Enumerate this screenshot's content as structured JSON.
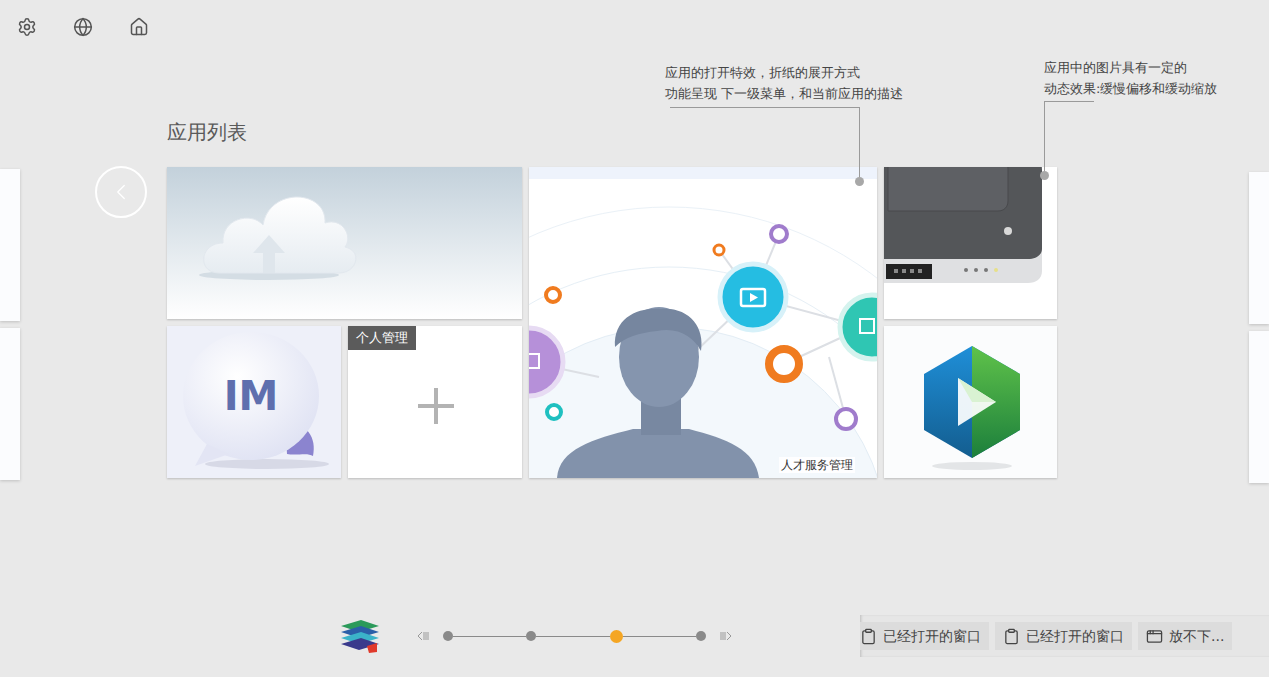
{
  "title": "应用列表",
  "annotations": [
    {
      "lines": [
        "应用的打开特效，折纸的展开方式",
        "功能呈现 下一级菜单，和当前应用的描述"
      ]
    },
    {
      "lines": [
        "应用中的图片具有一定的",
        "动态效果:缓慢偏移和缓动缩放"
      ]
    }
  ],
  "tiles": [
    {
      "kind": "cloud"
    },
    {
      "kind": "talent",
      "caption": "人才服务管理"
    },
    {
      "kind": "device"
    },
    {
      "kind": "im",
      "label": "IM"
    },
    {
      "kind": "add",
      "badge": "个人管理"
    },
    {
      "kind": "player"
    }
  ],
  "pager": {
    "pages": [
      {
        "selected": false
      },
      {
        "selected": false
      },
      {
        "selected": true
      },
      {
        "selected": false
      }
    ]
  },
  "taskbar": [
    {
      "label": "已经打开的窗口",
      "kind": "clipboard"
    },
    {
      "label": "已经打开的窗口",
      "kind": "clipboard"
    },
    {
      "label": "放不下...",
      "kind": "window"
    }
  ]
}
